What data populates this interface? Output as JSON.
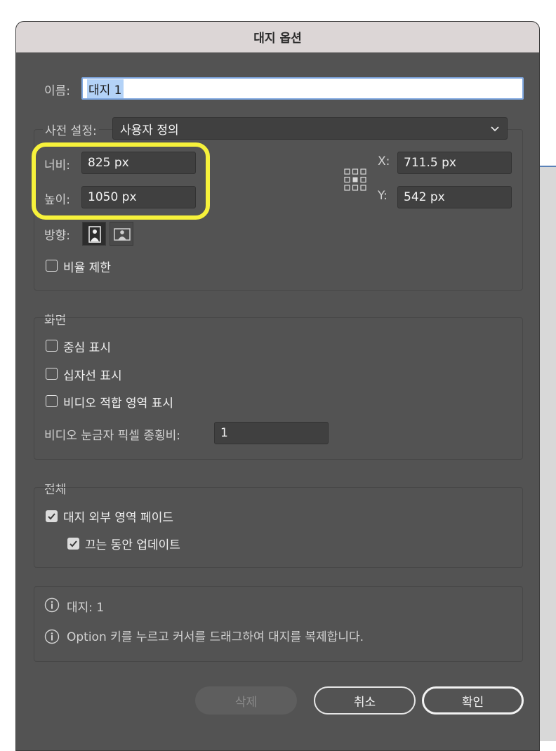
{
  "dialog": {
    "title": "대지 옵션"
  },
  "name": {
    "label": "이름:",
    "value": "대지 1"
  },
  "preset": {
    "label": "사전 설정:",
    "value": "사용자 정의"
  },
  "size": {
    "width_label": "너비:",
    "width_value": "825 px",
    "height_label": "높이:",
    "height_value": "1050 px"
  },
  "position": {
    "x_label": "X:",
    "x_value": "711.5 px",
    "y_label": "Y:",
    "y_value": "542 px"
  },
  "orientation": {
    "label": "방향:"
  },
  "constrain": {
    "label": "비율 제한",
    "checked": false
  },
  "display": {
    "heading": "화면",
    "center_mark": "중심 표시",
    "cross_hairs": "십자선 표시",
    "video_safe": "비디오 적합 영역 표시",
    "pixel_aspect_label": "비디오 눈금자 픽셀 종횡비:",
    "pixel_aspect_value": "1"
  },
  "global": {
    "heading": "전체",
    "fade_outside": "대지 외부 영역 페이드",
    "update_drag": "끄는 동안 업데이트"
  },
  "info": {
    "artboards": "대지: 1",
    "tip": "Option 키를 누르고 커서를 드래그하여 대지를 복제합니다."
  },
  "buttons": {
    "delete": "삭제",
    "cancel": "취소",
    "ok": "확인"
  },
  "colors": {
    "highlight": "#f7f23b",
    "dialog_bg": "#535353",
    "selection": "#b3d2f7"
  }
}
